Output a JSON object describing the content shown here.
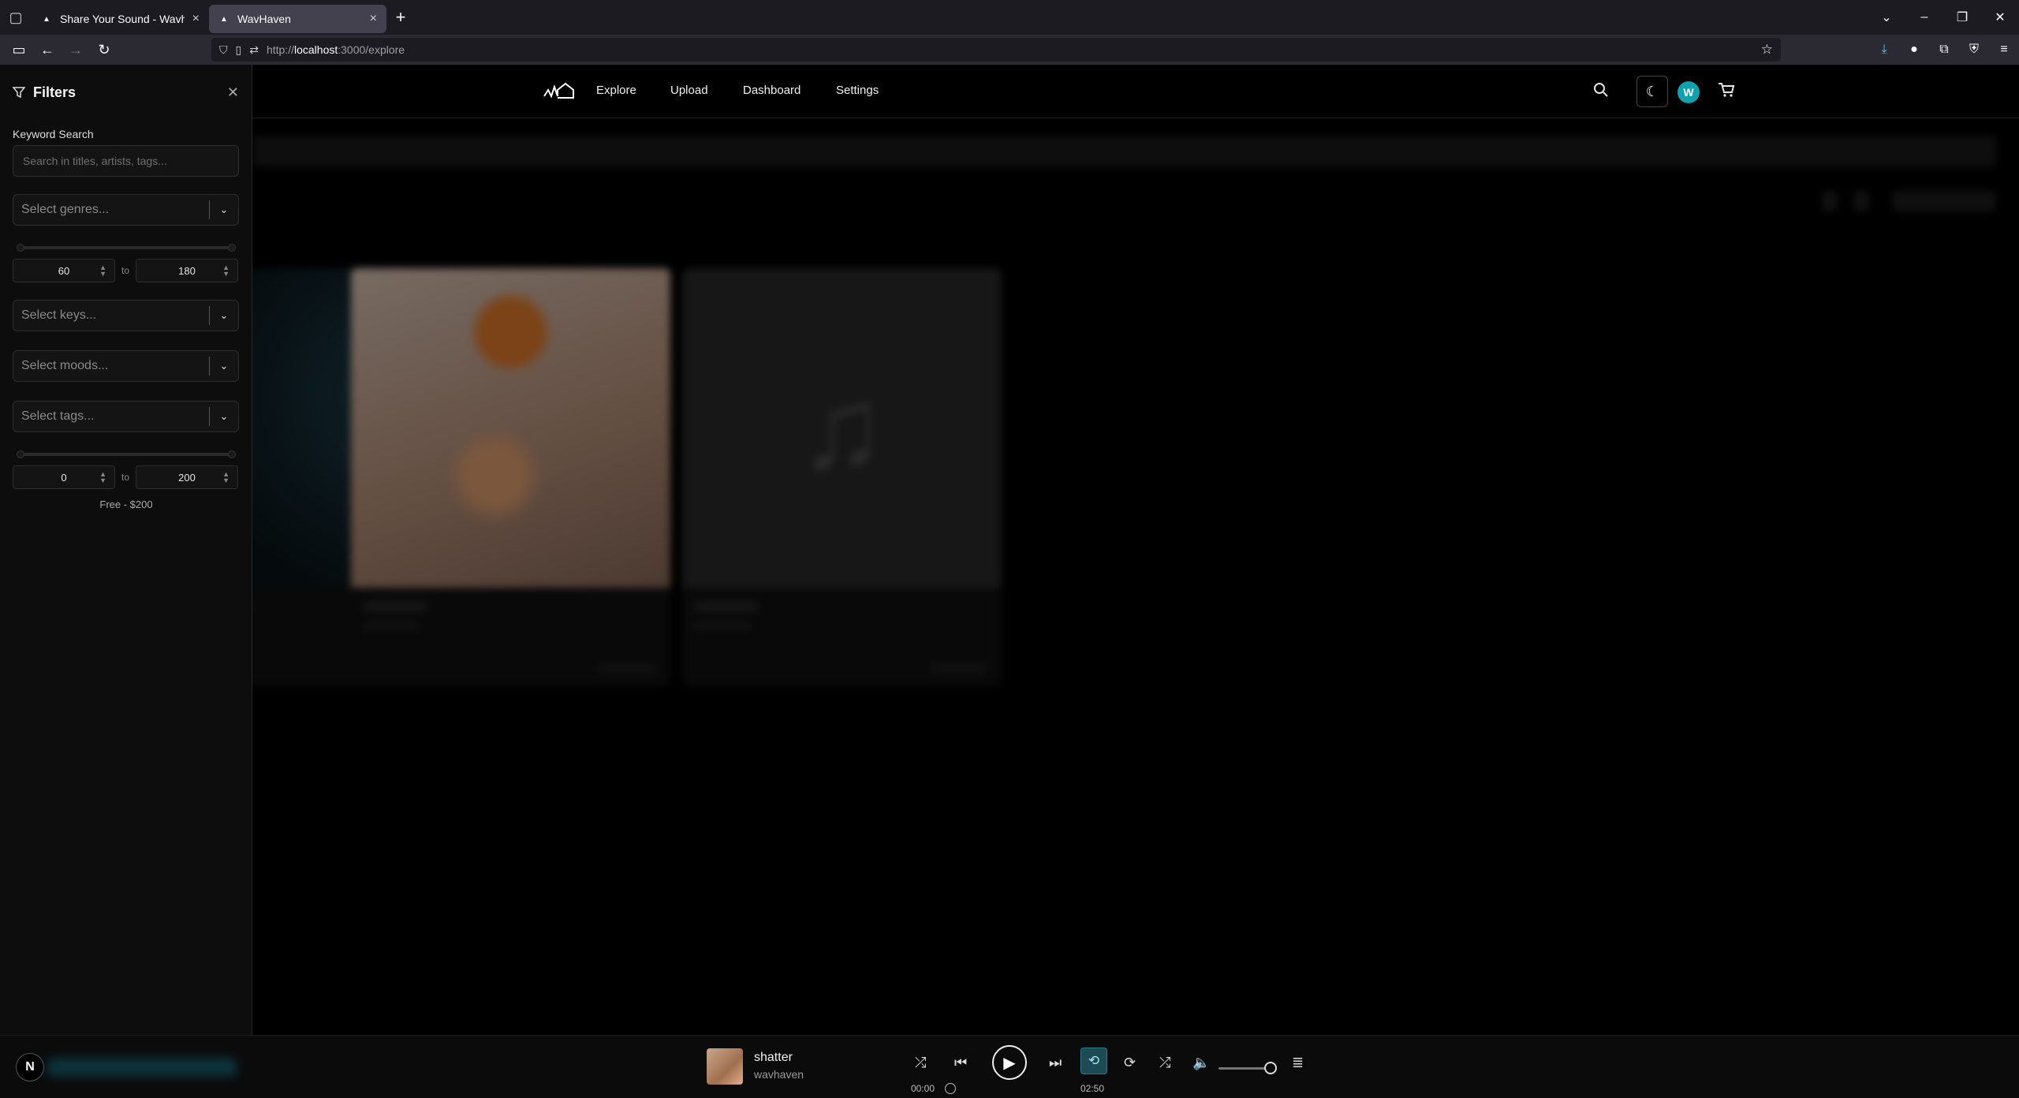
{
  "browser": {
    "tabs": [
      {
        "title": "Share Your Sound - Wavhaven",
        "active": false
      },
      {
        "title": "WavHaven",
        "active": true
      }
    ],
    "url_prefix": "http://",
    "url_host": "localhost",
    "url_rest": ":3000/explore"
  },
  "sidebar": {
    "title": "Filters",
    "keyword_label": "Keyword Search",
    "keyword_placeholder": "Search in titles, artists, tags...",
    "genres_placeholder": "Select genres...",
    "bpm_min": "60",
    "bpm_max": "180",
    "to_label": "to",
    "keys_placeholder": "Select keys...",
    "moods_placeholder": "Select moods...",
    "tags_placeholder": "Select tags...",
    "price_min": "0",
    "price_max": "200",
    "price_note": "Free - $200"
  },
  "nav": {
    "links": [
      "Explore",
      "Upload",
      "Dashboard",
      "Settings"
    ],
    "avatar_initial": "W"
  },
  "player": {
    "badge": "N",
    "title": "shatter",
    "artist": "wavhaven",
    "current_time": "00:00",
    "duration": "02:50",
    "volume": 0.85
  },
  "colors": {
    "accent": "#11a0b0",
    "repeat_active": "#1d4a55"
  }
}
